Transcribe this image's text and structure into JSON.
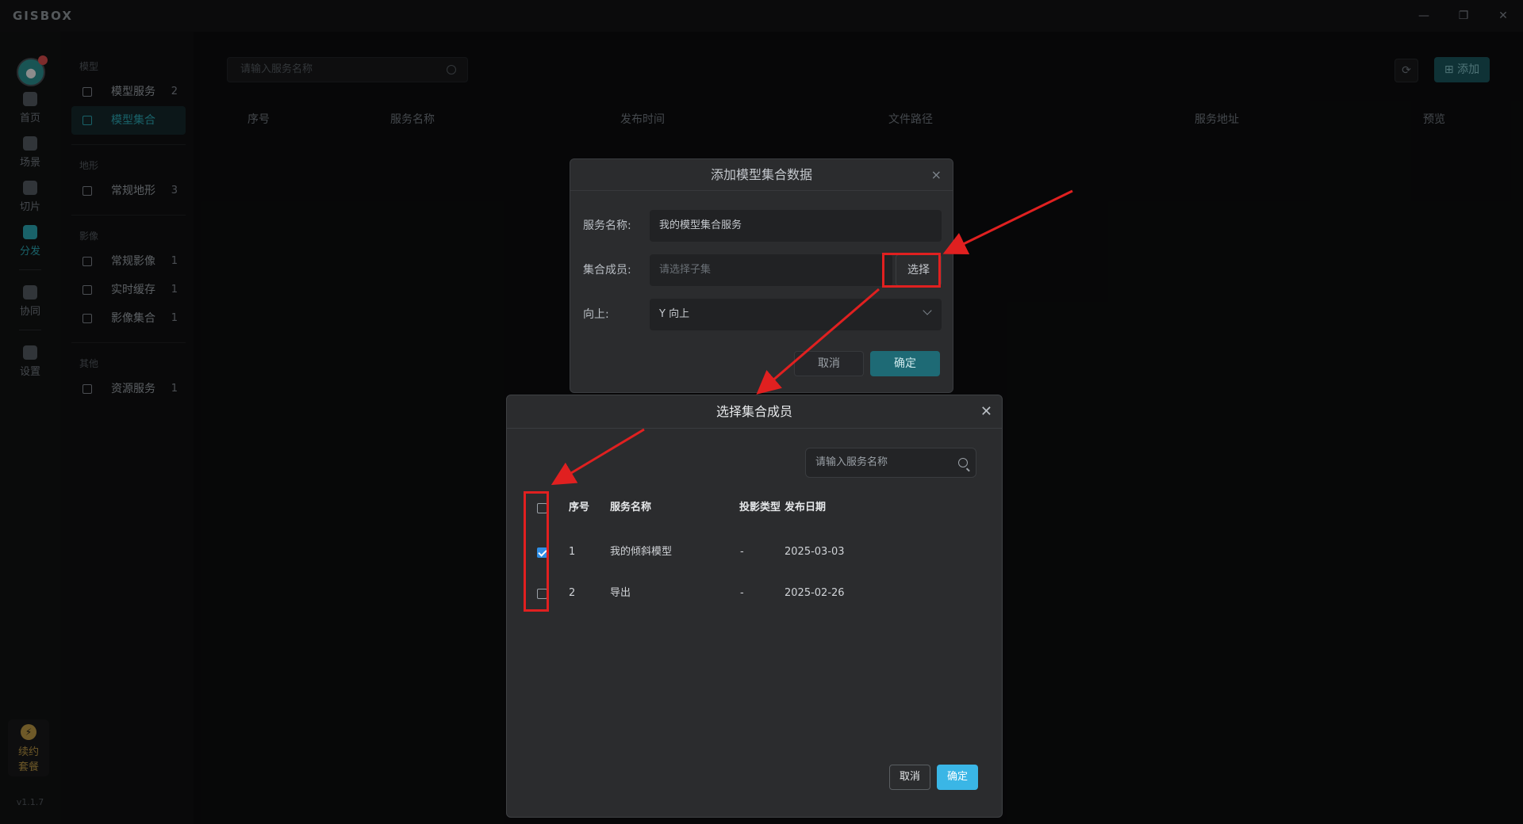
{
  "app": {
    "logo": "GISBOX",
    "window_controls": {
      "minimize": "—",
      "restore": "❐",
      "close": "✕"
    },
    "version": "v1.1.7"
  },
  "rail": {
    "items": [
      {
        "label": "首页",
        "icon": "home-icon"
      },
      {
        "label": "场景",
        "icon": "scene-icon"
      },
      {
        "label": "切片",
        "icon": "slice-icon"
      },
      {
        "label": "分发",
        "icon": "distribute-icon",
        "active": true
      },
      {
        "label": "协同",
        "icon": "collaborate-icon"
      },
      {
        "label": "设置",
        "icon": "settings-icon"
      }
    ],
    "renew": {
      "line1": "续约",
      "line2": "套餐",
      "icon": "lightning-icon"
    }
  },
  "sidebar": {
    "groups": [
      {
        "title": "模型",
        "items": [
          {
            "label": "模型服务",
            "count": "2"
          },
          {
            "label": "模型集合",
            "count": "",
            "active": true
          }
        ]
      },
      {
        "title": "地形",
        "items": [
          {
            "label": "常规地形",
            "count": "3"
          }
        ]
      },
      {
        "title": "影像",
        "items": [
          {
            "label": "常规影像",
            "count": "1"
          },
          {
            "label": "实时缓存",
            "count": "1"
          },
          {
            "label": "影像集合",
            "count": "1"
          }
        ]
      },
      {
        "title": "其他",
        "items": [
          {
            "label": "资源服务",
            "count": "1"
          }
        ]
      }
    ]
  },
  "main": {
    "search_placeholder": "请输入服务名称",
    "refresh_icon": "⟳",
    "add_label": "⊞ 添加",
    "columns": [
      "序号",
      "服务名称",
      "发布时间",
      "文件路径",
      "服务地址",
      "预览"
    ]
  },
  "dialog_add": {
    "title": "添加模型集合数据",
    "close": "×",
    "service_name_label": "服务名称:",
    "service_name_value": "我的模型集合服务",
    "members_label": "集合成员:",
    "members_placeholder": "请选择子集",
    "select_button": "选择",
    "up_label": "向上:",
    "up_value": "Y 向上",
    "cancel": "取消",
    "confirm": "确定"
  },
  "dialog_select": {
    "title": "选择集合成员",
    "close": "✕",
    "search_placeholder": "请输入服务名称",
    "columns": {
      "index": "序号",
      "name": "服务名称",
      "projection": "投影类型",
      "date": "发布日期"
    },
    "rows": [
      {
        "index": "1",
        "name": "我的倾斜模型",
        "projection": "-",
        "date": "2025-03-03",
        "checked": true
      },
      {
        "index": "2",
        "name": "导出",
        "projection": "-",
        "date": "2025-02-26",
        "checked": false
      }
    ],
    "cancel": "取消",
    "confirm": "确定"
  },
  "colors": {
    "accent": "#2fb3c0",
    "confirm_blue": "#3ab6e6",
    "checkbox_blue": "#2f8ee5",
    "annotation_red": "#e02020"
  }
}
